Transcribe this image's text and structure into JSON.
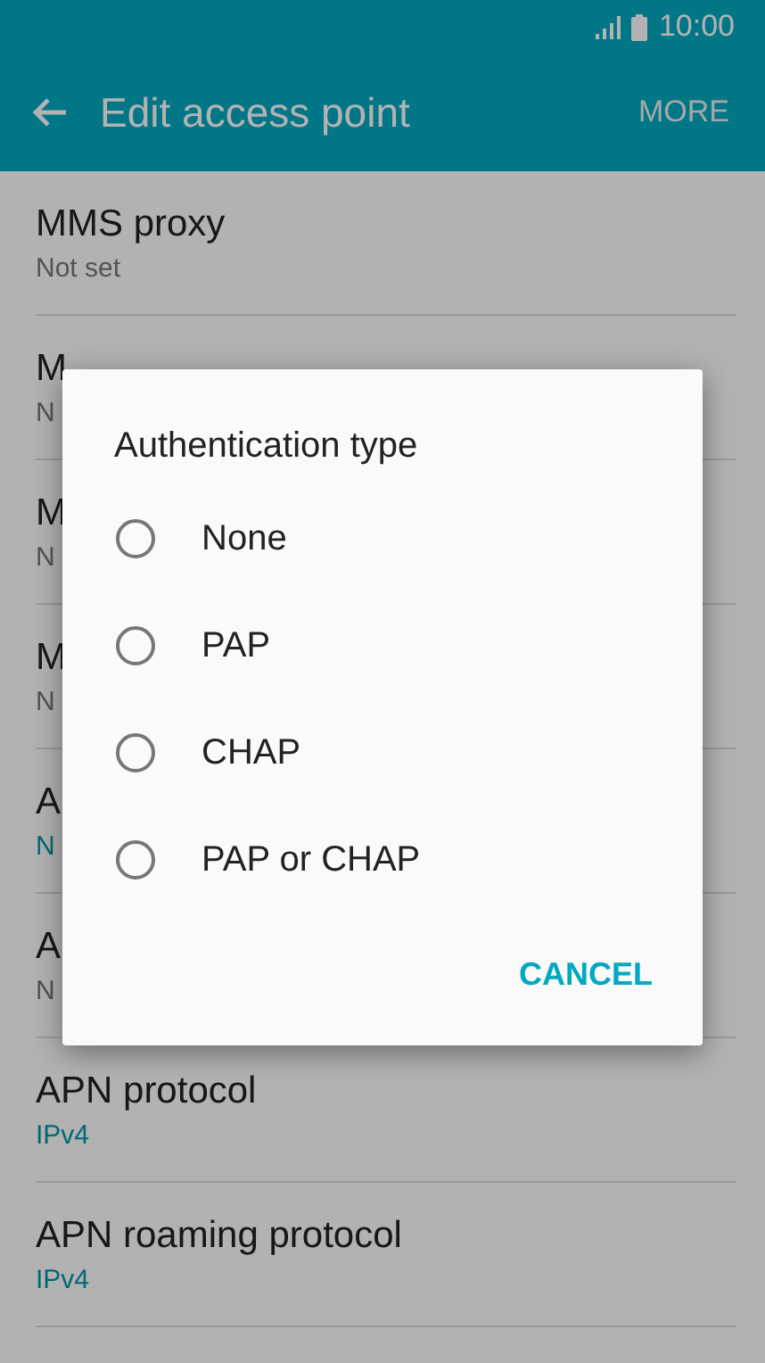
{
  "status_bar": {
    "time": "10:00"
  },
  "app_bar": {
    "title": "Edit access point",
    "action": "MORE"
  },
  "settings": [
    {
      "title": "MMS proxy",
      "value": "Not set",
      "kind": "plain"
    },
    {
      "title": "M",
      "value": "N",
      "kind": "plain"
    },
    {
      "title": "M",
      "value": "N",
      "kind": "plain"
    },
    {
      "title": "M",
      "value": "N",
      "kind": "plain"
    },
    {
      "title": "A",
      "value": "N",
      "kind": "accent"
    },
    {
      "title": "A",
      "value": "N",
      "kind": "plain"
    },
    {
      "title": "APN protocol",
      "value": "IPv4",
      "kind": "accent"
    },
    {
      "title": "APN roaming protocol",
      "value": "IPv4",
      "kind": "accent"
    }
  ],
  "dialog": {
    "title": "Authentication type",
    "options": [
      {
        "label": "None",
        "selected": false
      },
      {
        "label": "PAP",
        "selected": false
      },
      {
        "label": "CHAP",
        "selected": false
      },
      {
        "label": "PAP or CHAP",
        "selected": false
      }
    ],
    "button": "CANCEL"
  }
}
